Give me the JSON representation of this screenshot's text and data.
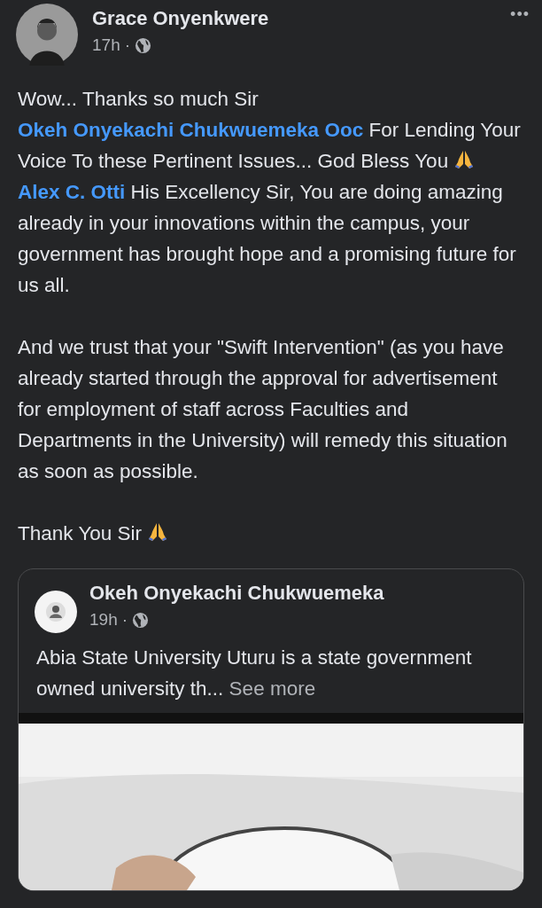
{
  "post": {
    "author": "Grace Onyenkwere",
    "time": "17h",
    "separator": "·",
    "menu": "•••",
    "paragraphs": [
      [
        {
          "kind": "text",
          "text": "Wow... Thanks so much Sir "
        },
        {
          "kind": "mention",
          "text": "Okeh Onyekachi Chukwuemeka Ooc"
        },
        {
          "kind": "text",
          "text": "  For Lending Your Voice To these Pertinent Issues... God Bless You "
        },
        {
          "kind": "emoji"
        },
        {
          "kind": "mention",
          "text": "Alex C. Otti"
        },
        {
          "kind": "text",
          "text": " His Excellency Sir, You are doing amazing already in your innovations within the campus, your government has brought hope and a promising future for us all."
        }
      ],
      [
        {
          "kind": "text",
          "text": "And we trust that your \"Swift Intervention\" (as you have already started through the approval for advertisement for employment of staff across Faculties and Departments in the University) will remedy this situation as soon as possible."
        }
      ],
      [
        {
          "kind": "text",
          "text": "Thank You Sir "
        },
        {
          "kind": "emoji"
        }
      ]
    ]
  },
  "shared_post": {
    "author": "Okeh Onyekachi Chukwuemeka",
    "time": "19h",
    "separator": "·",
    "text": "Abia State University Uturu is a state government owned university th...",
    "see_more": "See more"
  }
}
